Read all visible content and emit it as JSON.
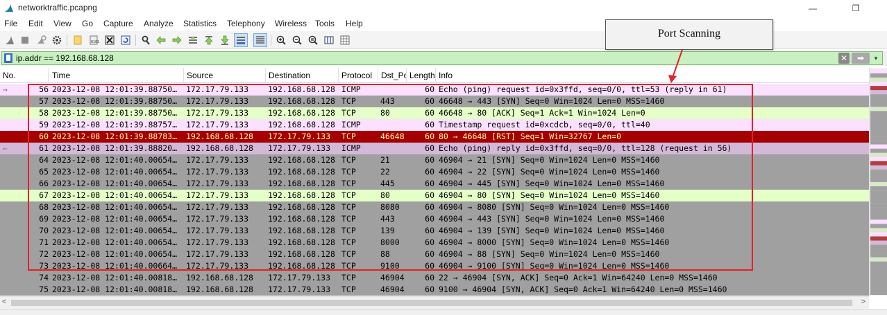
{
  "window": {
    "title": "networktraffic.pcapng",
    "minimize_glyph": "—",
    "restore_glyph": "❐"
  },
  "menu": [
    "File",
    "Edit",
    "View",
    "Go",
    "Capture",
    "Analyze",
    "Statistics",
    "Telephony",
    "Wireless",
    "Tools",
    "Help"
  ],
  "toolbar_icons": [
    "shark-fin-start-icon",
    "stop-icon",
    "restart-icon",
    "options-gear-icon",
    "open-file-icon",
    "file-set-icon",
    "close-file-icon",
    "reload-icon",
    "find-packet-icon",
    "go-back-icon",
    "go-forward-icon",
    "go-to-packet-icon",
    "first-packet-icon",
    "last-packet-icon",
    "autoscroll-icon",
    "colorize-icon",
    "zoom-in-icon",
    "zoom-out-icon",
    "zoom-reset-icon",
    "resize-columns-icon",
    "grid-icon"
  ],
  "filter": {
    "value": "ip.addr == 192.168.68.128",
    "clear_glyph": "✕",
    "apply_glyph": "➡",
    "dropdown_glyph": "▾"
  },
  "columns": [
    "No.",
    "Time",
    "Source",
    "Destination",
    "Protocol",
    "Dst_Port",
    "Length",
    "Info"
  ],
  "packets": [
    {
      "no": "56",
      "time": "2023-12-08 12:01:39.88750…",
      "src": "172.17.79.133",
      "dst": "192.168.68.128",
      "proto": "ICMP",
      "dport": "",
      "len": "60",
      "info": "Echo (ping) request  id=0x3ffd, seq=0/0, ttl=53 (reply in 61)",
      "bg": "#fce0ff",
      "fg": "#000000",
      "marker": "→"
    },
    {
      "no": "57",
      "time": "2023-12-08 12:01:39.88750…",
      "src": "172.17.79.133",
      "dst": "192.168.68.128",
      "proto": "TCP",
      "dport": "443",
      "len": "60",
      "info": "46648 → 443 [SYN] Seq=0 Win=1024 Len=0 MSS=1460",
      "bg": "#a0a0a0",
      "fg": "#000000",
      "marker": ""
    },
    {
      "no": "58",
      "time": "2023-12-08 12:01:39.88750…",
      "src": "172.17.79.133",
      "dst": "192.168.68.128",
      "proto": "TCP",
      "dport": "80",
      "len": "60",
      "info": "46648 → 80 [ACK] Seq=1 Ack=1 Win=1024 Len=0",
      "bg": "#e4ffc7",
      "fg": "#000000",
      "marker": ""
    },
    {
      "no": "59",
      "time": "2023-12-08 12:01:39.88757…",
      "src": "172.17.79.133",
      "dst": "192.168.68.128",
      "proto": "ICMP",
      "dport": "",
      "len": "60",
      "info": "Timestamp request    id=0xcdcb, seq=0/0, ttl=40",
      "bg": "#fce0ff",
      "fg": "#000000",
      "marker": ""
    },
    {
      "no": "60",
      "time": "2023-12-08 12:01:39.88783…",
      "src": "192.168.68.128",
      "dst": "172.17.79.133",
      "proto": "TCP",
      "dport": "46648",
      "len": "60",
      "info": "80 → 46648 [RST] Seq=1 Win=32767 Len=0",
      "bg": "#a40000",
      "fg": "#fffc9c",
      "marker": ""
    },
    {
      "no": "61",
      "time": "2023-12-08 12:01:39.88820…",
      "src": "192.168.68.128",
      "dst": "172.17.79.133",
      "proto": "ICMP",
      "dport": "",
      "len": "60",
      "info": "Echo (ping) reply    id=0x3ffd, seq=0/0, ttl=128 (request in 56)",
      "bg": "#d4b8d8",
      "fg": "#000000",
      "marker": "←"
    },
    {
      "no": "64",
      "time": "2023-12-08 12:01:40.00654…",
      "src": "172.17.79.133",
      "dst": "192.168.68.128",
      "proto": "TCP",
      "dport": "21",
      "len": "60",
      "info": "46904 → 21 [SYN] Seq=0 Win=1024 Len=0 MSS=1460",
      "bg": "#a0a0a0",
      "fg": "#000000",
      "marker": ""
    },
    {
      "no": "65",
      "time": "2023-12-08 12:01:40.00654…",
      "src": "172.17.79.133",
      "dst": "192.168.68.128",
      "proto": "TCP",
      "dport": "22",
      "len": "60",
      "info": "46904 → 22 [SYN] Seq=0 Win=1024 Len=0 MSS=1460",
      "bg": "#a0a0a0",
      "fg": "#000000",
      "marker": ""
    },
    {
      "no": "66",
      "time": "2023-12-08 12:01:40.00654…",
      "src": "172.17.79.133",
      "dst": "192.168.68.128",
      "proto": "TCP",
      "dport": "445",
      "len": "60",
      "info": "46904 → 445 [SYN] Seq=0 Win=1024 Len=0 MSS=1460",
      "bg": "#a0a0a0",
      "fg": "#000000",
      "marker": ""
    },
    {
      "no": "67",
      "time": "2023-12-08 12:01:40.00654…",
      "src": "172.17.79.133",
      "dst": "192.168.68.128",
      "proto": "TCP",
      "dport": "80",
      "len": "60",
      "info": "46904 → 80 [SYN] Seq=0 Win=1024 Len=0 MSS=1460",
      "bg": "#e4ffc7",
      "fg": "#000000",
      "marker": ""
    },
    {
      "no": "68",
      "time": "2023-12-08 12:01:40.00654…",
      "src": "172.17.79.133",
      "dst": "192.168.68.128",
      "proto": "TCP",
      "dport": "8080",
      "len": "60",
      "info": "46904 → 8080 [SYN] Seq=0 Win=1024 Len=0 MSS=1460",
      "bg": "#a0a0a0",
      "fg": "#000000",
      "marker": ""
    },
    {
      "no": "69",
      "time": "2023-12-08 12:01:40.00654…",
      "src": "172.17.79.133",
      "dst": "192.168.68.128",
      "proto": "TCP",
      "dport": "443",
      "len": "60",
      "info": "46904 → 443 [SYN] Seq=0 Win=1024 Len=0 MSS=1460",
      "bg": "#a0a0a0",
      "fg": "#000000",
      "marker": ""
    },
    {
      "no": "70",
      "time": "2023-12-08 12:01:40.00654…",
      "src": "172.17.79.133",
      "dst": "192.168.68.128",
      "proto": "TCP",
      "dport": "139",
      "len": "60",
      "info": "46904 → 139 [SYN] Seq=0 Win=1024 Len=0 MSS=1460",
      "bg": "#a0a0a0",
      "fg": "#000000",
      "marker": ""
    },
    {
      "no": "71",
      "time": "2023-12-08 12:01:40.00654…",
      "src": "172.17.79.133",
      "dst": "192.168.68.128",
      "proto": "TCP",
      "dport": "8000",
      "len": "60",
      "info": "46904 → 8000 [SYN] Seq=0 Win=1024 Len=0 MSS=1460",
      "bg": "#a0a0a0",
      "fg": "#000000",
      "marker": ""
    },
    {
      "no": "72",
      "time": "2023-12-08 12:01:40.00654…",
      "src": "172.17.79.133",
      "dst": "192.168.68.128",
      "proto": "TCP",
      "dport": "88",
      "len": "60",
      "info": "46904 → 88 [SYN] Seq=0 Win=1024 Len=0 MSS=1460",
      "bg": "#a0a0a0",
      "fg": "#000000",
      "marker": ""
    },
    {
      "no": "73",
      "time": "2023-12-08 12:01:40.00664…",
      "src": "172.17.79.133",
      "dst": "192.168.68.128",
      "proto": "TCP",
      "dport": "9100",
      "len": "60",
      "info": "46904 → 9100 [SYN] Seq=0 Win=1024 Len=0 MSS=1460",
      "bg": "#a0a0a0",
      "fg": "#000000",
      "marker": ""
    },
    {
      "no": "74",
      "time": "2023-12-08 12:01:40.00818…",
      "src": "192.168.68.128",
      "dst": "172.17.79.133",
      "proto": "TCP",
      "dport": "46904",
      "len": "60",
      "info": "22 → 46904 [SYN, ACK] Seq=0 Ack=1 Win=64240 Len=0 MSS=1460",
      "bg": "#a0a0a0",
      "fg": "#000000",
      "marker": ""
    },
    {
      "no": "75",
      "time": "2023-12-08 12:01:40.00818…",
      "src": "192.168.68.128",
      "dst": "172.17.79.133",
      "proto": "TCP",
      "dport": "46904",
      "len": "60",
      "info": "9100 → 46904 [SYN, ACK] Seq=0 Ack=1 Win=64240 Len=0 MSS=1460",
      "bg": "#a0a0a0",
      "fg": "#000000",
      "marker": ""
    }
  ],
  "annotation": {
    "label": "Port Scanning",
    "box_color": "#e4202a"
  },
  "scrollbar": {
    "left_glyph": "<",
    "right_glyph": ">"
  }
}
